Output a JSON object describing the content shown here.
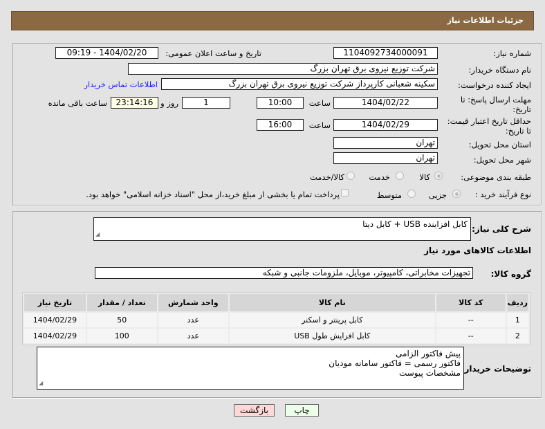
{
  "header": {
    "title": "جزئیات اطلاعات نیاز"
  },
  "form": {
    "need_number_label": "شماره نیاز:",
    "need_number": "1104092734000091",
    "announce_label": "تاریخ و ساعت اعلان عمومی:",
    "announce_value": "1404/02/20 - 09:19",
    "buyer_label": "نام دستگاه خریدار:",
    "buyer_value": "شرکت توزیع نیروی برق تهران بزرگ",
    "creator_label": "ایجاد کننده درخواست:",
    "creator_value": "سکینه شعبانی کارپرداز شرکت توزیع نیروی برق تهران بزرگ",
    "contact_link": "اطلاعات تماس خریدار",
    "deadline_label_1": "مهلت ارسال پاسخ: تا",
    "deadline_label_2": "تاریخ:",
    "deadline_date": "1404/02/22",
    "time_label": "ساعت",
    "deadline_time": "10:00",
    "days": "1",
    "days_label": "روز و",
    "remaining": "23:14:16",
    "remaining_label": "ساعت باقی مانده",
    "validity_label_1": "حداقل تاریخ اعتبار قیمت:",
    "validity_label_2": "تا تاریخ:",
    "validity_date": "1404/02/29",
    "validity_time": "16:00",
    "province_label": "استان محل تحویل:",
    "province": "تهران",
    "city_label": "شهر محل تحویل:",
    "city": "تهران",
    "category_label": "طبقه بندی موضوعی:",
    "category_options": [
      "کالا",
      "خدمت",
      "کالا/خدمت"
    ],
    "purchase_label": "نوع فرآیند خرید :",
    "purchase_options": [
      "جزیی",
      "متوسط"
    ],
    "payment_note": "پرداخت تمام یا بخشی از مبلغ خرید،از محل \"اسناد خزانه اسلامی\" خواهد بود."
  },
  "details": {
    "summary_label": "شرح کلی نیاز:",
    "summary": "کابل افزاینده USB + کابل دیتا",
    "goods_title": "اطلاعات کالاهای مورد نیاز",
    "group_label": "گروه کالا:",
    "group": "تجهیزات مخابراتی، کامپیوتر، موبایل، ملزومات جانبی و شبکه",
    "table": {
      "headers": [
        "ردیف",
        "کد کالا",
        "نام کالا",
        "واحد شمارش",
        "تعداد / مقدار",
        "تاریخ نیاز"
      ],
      "rows": [
        [
          "1",
          "--",
          "کابل پرینتر و اسکنر",
          "عدد",
          "50",
          "1404/02/29"
        ],
        [
          "2",
          "--",
          "کابل افزایش طول USB",
          "عدد",
          "100",
          "1404/02/29"
        ]
      ]
    },
    "notes_label": "توضیحات خریدار:",
    "notes": [
      "پیش فاکتور الزامی",
      "فاکتور رسمی = فاکتور سامانه مودیان",
      "مشخصات پیوست"
    ]
  },
  "buttons": {
    "back": "بازگشت",
    "print": "چاپ"
  }
}
